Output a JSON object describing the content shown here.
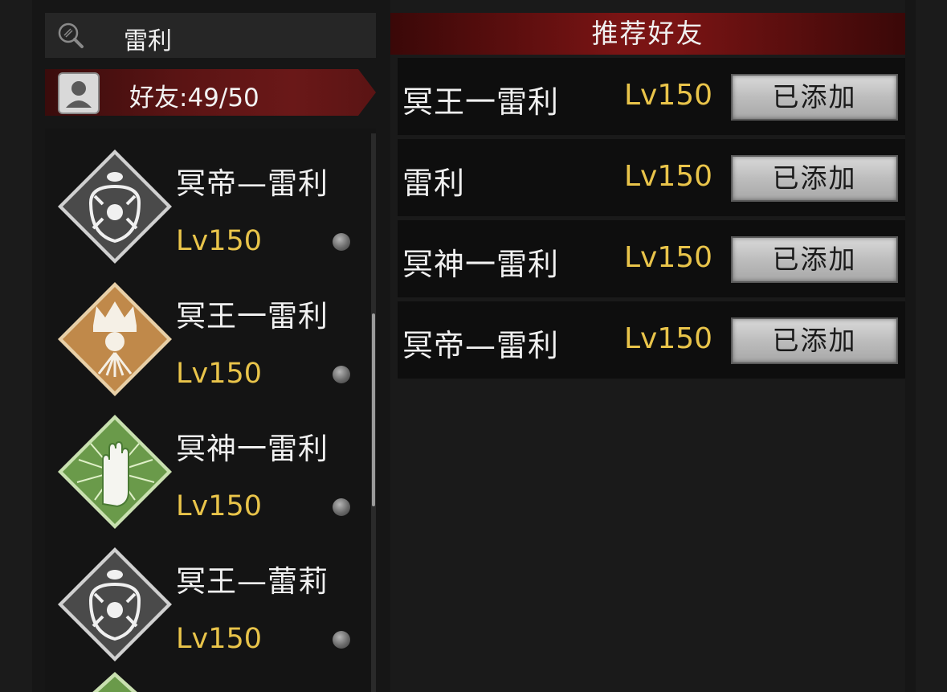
{
  "search": {
    "value": "雷利",
    "icon": "search-icon"
  },
  "friends_header": {
    "label": "好友:49/50",
    "icon": "user-avatar-icon"
  },
  "friends": [
    {
      "name": "冥帝—雷利",
      "level": "Lv150",
      "emblem": "spider-emblem-icon",
      "emblem_color": "#4a4a4a"
    },
    {
      "name": "冥王一雷利",
      "level": "Lv150",
      "emblem": "crown-skull-emblem-icon",
      "emblem_color": "#c0894a"
    },
    {
      "name": "冥神一雷利",
      "level": "Lv150",
      "emblem": "hand-emblem-icon",
      "emblem_color": "#6a9a4a"
    },
    {
      "name": "冥王—蕾莉",
      "level": "Lv150",
      "emblem": "spider-emblem-icon",
      "emblem_color": "#4a4a4a"
    }
  ],
  "recommend": {
    "title": "推荐好友",
    "rows": [
      {
        "name": "冥王一雷利",
        "level": "Lv150",
        "button": "已添加"
      },
      {
        "name": "雷利",
        "level": "Lv150",
        "button": "已添加"
      },
      {
        "name": "冥神一雷利",
        "level": "Lv150",
        "button": "已添加"
      },
      {
        "name": "冥帝—雷利",
        "level": "Lv150",
        "button": "已添加"
      }
    ]
  },
  "colors": {
    "level_text": "#e9c44a",
    "header_red": "#7a1414"
  }
}
